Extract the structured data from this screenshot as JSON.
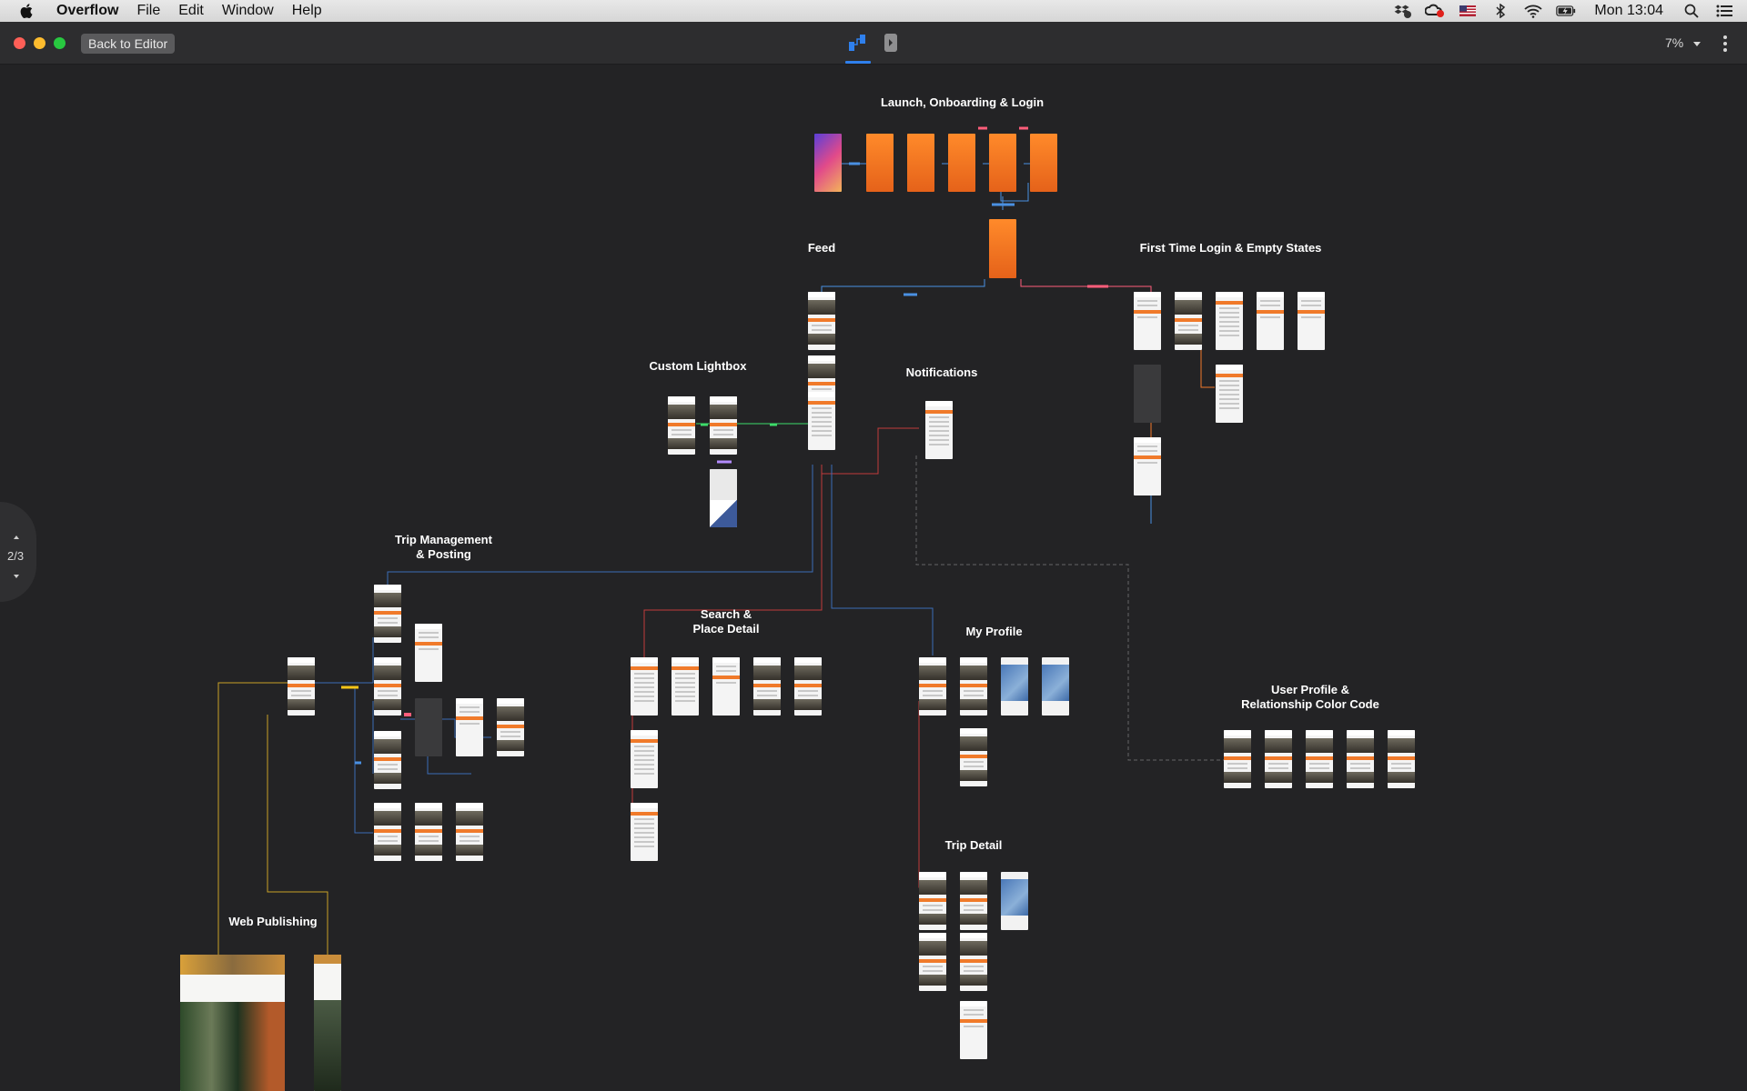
{
  "menubar": {
    "app_name": "Overflow",
    "menus": [
      "File",
      "Edit",
      "Window",
      "Help"
    ],
    "clock": "Mon 13:04"
  },
  "titlebar": {
    "back_button": "Back to Editor",
    "zoom": "7%"
  },
  "pager": {
    "label": "2/3"
  },
  "sections": {
    "launch": "Launch, Onboarding & Login",
    "feed": "Feed",
    "first_time": "First Time Login & Empty States",
    "lightbox": "Custom Lightbox",
    "notifications": "Notifications",
    "trip_mgmt": "Trip Management\n& Posting",
    "search": "Search &\nPlace Detail",
    "my_profile": "My Profile",
    "user_profile": "User Profile &\nRelationship Color Code",
    "trip_detail": "Trip Detail",
    "web_publishing": "Web Publishing"
  },
  "colors": {
    "canvas": "#232325",
    "accent": "#2f80ed",
    "brand_orange": "#f07a2a",
    "connector_blue": "#4a90e2",
    "connector_pink": "#ff5d7a",
    "connector_green": "#3ddc6a",
    "connector_yellow": "#f5c518"
  }
}
